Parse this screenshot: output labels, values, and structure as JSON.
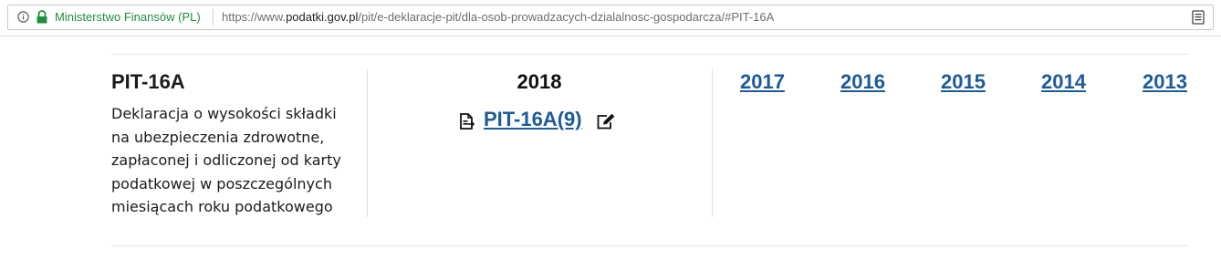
{
  "browser": {
    "site_identity": "Ministerstwo Finansów (PL)",
    "url_prefix": "https://www.",
    "url_host": "podatki.gov.pl",
    "url_path": "/pit/e-deklaracje-pit/dla-osob-prowadzacych-dzialalnosc-gospodarcza/#PIT-16A"
  },
  "form": {
    "title": "PIT-16A",
    "description": "Deklaracja o wysokości składki na ubezpieczenia zdrowotne, zapłaconej i odliczonej od karty podatkowej w poszczególnych miesiącach roku podatkowego",
    "current_year": "2018",
    "current_link": "PIT-16A(9)"
  },
  "archive_years": [
    "2017",
    "2016",
    "2015",
    "2014",
    "2013"
  ],
  "colors": {
    "link": "#1d5a99",
    "secure_green": "#1e8e3e"
  }
}
